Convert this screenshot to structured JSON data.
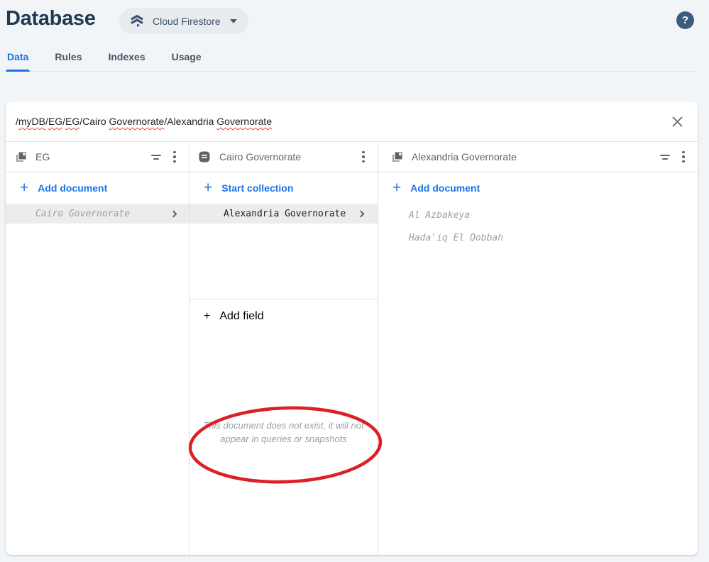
{
  "header": {
    "title": "Database",
    "selector_label": "Cloud Firestore",
    "help_glyph": "?"
  },
  "tabs": [
    {
      "label": "Data",
      "active": true
    },
    {
      "label": "Rules",
      "active": false
    },
    {
      "label": "Indexes",
      "active": false
    },
    {
      "label": "Usage",
      "active": false
    }
  ],
  "pathbar": {
    "segments": [
      {
        "text": "/"
      },
      {
        "text": "myDB",
        "misspelled": true
      },
      {
        "text": "/"
      },
      {
        "text": "EG",
        "misspelled": true
      },
      {
        "text": "/"
      },
      {
        "text": "EG",
        "misspelled": true
      },
      {
        "text": "/"
      },
      {
        "text": "Cairo "
      },
      {
        "text": "Governorate",
        "misspelled": true
      },
      {
        "text": "/"
      },
      {
        "text": "Alexandria "
      },
      {
        "text": "Governorate",
        "misspelled": true
      }
    ],
    "full_path": "/myDB/EG/EG/Cairo Governorate/Alexandria Governorate"
  },
  "columns": {
    "col1": {
      "title": "EG",
      "type": "collection",
      "add_label": "Add document",
      "rows": [
        {
          "name": "Cairo Governorate",
          "missing": true,
          "selected": true
        }
      ]
    },
    "col2": {
      "title": "Cairo Governorate",
      "type": "document",
      "start_collection_label": "Start collection",
      "rows": [
        {
          "name": "Alexandria Governorate",
          "missing": false,
          "selected": true
        }
      ],
      "add_field_label": "Add field",
      "notice_line1": "This document does not exist, it will not",
      "notice_line2": "appear in queries or snapshots"
    },
    "col3": {
      "title": "Alexandria Governorate",
      "type": "collection",
      "add_label": "Add document",
      "rows": [
        {
          "name": "Al Azbakeya",
          "missing": true
        },
        {
          "name": "Hada'iq El Qobbah",
          "missing": true
        }
      ]
    }
  },
  "icons": {
    "plus": "+",
    "firestore": "firestore-logo",
    "collection": "collection-icon",
    "document": "document-icon",
    "filter": "filter-list",
    "kebab": "more-vert",
    "close": "close-x",
    "help": "help-circle"
  },
  "colors": {
    "accent_blue": "#1a73e8",
    "title_navy": "#203a53",
    "annotation_red": "#dc2027",
    "selected_row_bg": "#ececec",
    "muted_gray": "#9aa0a6",
    "icon_gray": "#5f6368",
    "page_bg": "#f2f5f8"
  }
}
